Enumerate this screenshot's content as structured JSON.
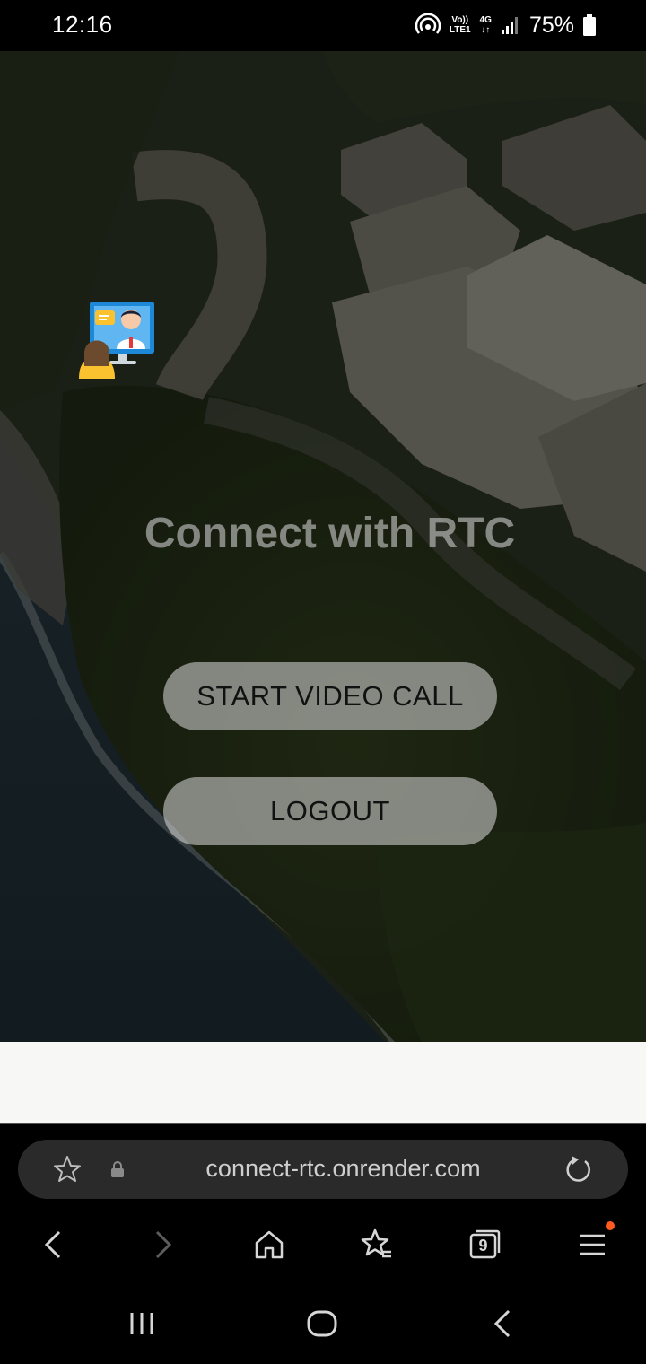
{
  "status_bar": {
    "time": "12:16",
    "volte_line1": "Vo))",
    "volte_line2": "LTE1",
    "network_line1": "4G",
    "network_line2": "↓↑",
    "battery": "75%"
  },
  "page": {
    "title": "Connect with RTC",
    "start_call_label": "START VIDEO CALL",
    "logout_label": "LOGOUT"
  },
  "browser": {
    "url": "connect-rtc.onrender.com",
    "tab_count": "9",
    "menu_has_notification": true,
    "notification_color": "#ff5a1f"
  },
  "icons": {
    "status": [
      "hotspot-icon",
      "signal-icon",
      "battery-icon"
    ],
    "url_bar": [
      "bookmark-star-icon",
      "lock-icon",
      "reload-icon"
    ],
    "nav": [
      "back-icon",
      "forward-icon",
      "home-icon",
      "bookmarks-icon",
      "tabs-icon",
      "menu-icon"
    ],
    "system": [
      "recents-icon",
      "home-circle-icon",
      "system-back-icon"
    ]
  }
}
